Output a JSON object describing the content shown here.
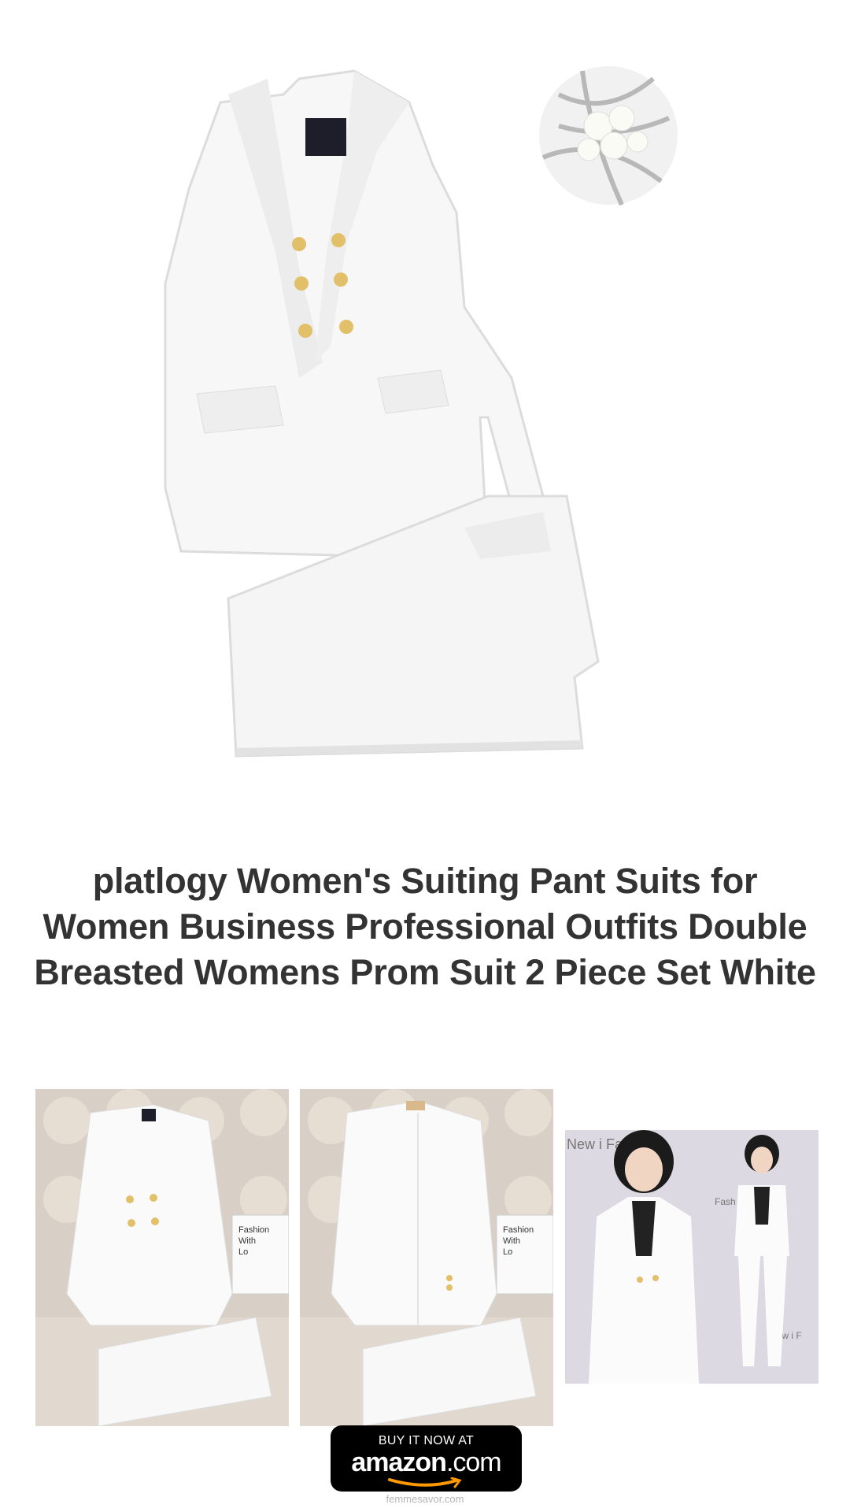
{
  "product": {
    "title": "platlogy Women's Suiting Pant Suits for Women Business Professional Outfits Double Breasted Womens Prom Suit 2 Piece Set White"
  },
  "images": {
    "hero": "white-suit-product-image",
    "thumbnails": [
      "suit-front-on-sofa",
      "suit-back-on-sofa",
      "model-wearing-suit"
    ]
  },
  "thumb_text": {
    "book_line1": "Fashion",
    "book_line2": "With",
    "book_line3": "Lo",
    "backdrop_1": "New i Fa",
    "backdrop_2": "Fash",
    "backdrop_3": "New i F"
  },
  "buy_button": {
    "top_text": "BUY IT NOW AT",
    "brand_text": "amazon",
    "brand_suffix": ".com"
  },
  "footer": {
    "site": "femmesavor.com"
  },
  "colors": {
    "title": "#333333",
    "button_bg": "#000000",
    "smile_orange": "#ff9900",
    "footer": "#b5b5b5"
  }
}
